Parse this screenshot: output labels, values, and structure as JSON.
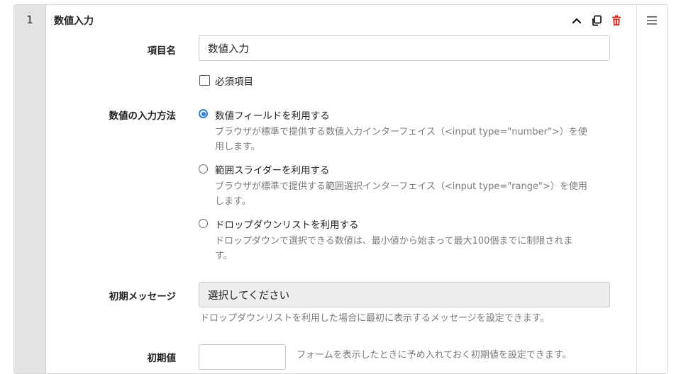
{
  "row": {
    "index": "1",
    "title": "数値入力",
    "tools": {
      "collapse_icon": "chevron-up-icon",
      "copy_icon": "copy-icon",
      "delete_icon": "trash-icon",
      "delete_color": "#d9352b"
    },
    "handle_icon": "hamburger-icon"
  },
  "fields": {
    "item_name": {
      "label": "項目名",
      "value": "数値入力",
      "required_label": "必須項目",
      "required_checked": false
    },
    "input_method": {
      "label": "数値の入力方法",
      "options": [
        {
          "label": "数値フィールドを利用する",
          "help_line1": "ブラウザが標準で提供する数値入力インターフェイス（<input type=\"number\">）を使",
          "help_line2": "用します。",
          "selected": true
        },
        {
          "label": "範囲スライダーを利用する",
          "help_line1": "ブラウザが標準で提供する範囲選択インターフェイス（<input type=\"range\">）を使用",
          "help_line2": "します。",
          "selected": false
        },
        {
          "label": "ドロップダウンリストを利用する",
          "help_line1": "ドロップダウンで選択できる数値は、最小値から始まって最大100個までに制限されま",
          "help_line2": "す。",
          "selected": false
        }
      ],
      "accent": "#2f7fd8"
    },
    "initial_message": {
      "label": "初期メッセージ",
      "value": "選択してください",
      "help": "ドロップダウンリストを利用した場合に最初に表示するメッセージを設定できます。"
    },
    "initial_value": {
      "label": "初期値",
      "value": "",
      "help": "フォームを表示したときに予め入れておく初期値を設定できます。"
    }
  }
}
